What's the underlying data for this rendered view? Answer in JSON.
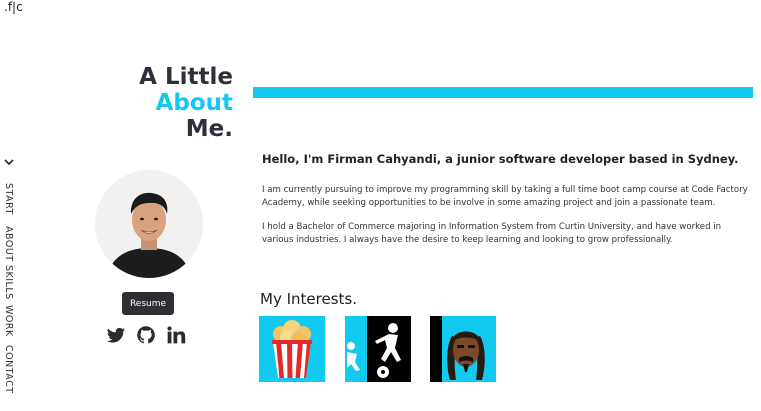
{
  "logo": {
    "text": ".f|c"
  },
  "nav": {
    "items": [
      "START",
      "ABOUT",
      "SKILLS",
      "WORK",
      "CONTACT"
    ]
  },
  "title": {
    "part1": "A Little ",
    "accent": "About",
    "part2": "Me."
  },
  "profile": {
    "resume_label": "Resume",
    "socials": [
      "twitter-icon",
      "github-icon",
      "linkedin-icon"
    ]
  },
  "about": {
    "greeting": "Hello, I'm Firman Cahyandi, a junior software developer based in Sydney.",
    "paragraph1": "I am currently pursuing to improve my programming skill by taking a full time boot camp course at Code Factory Academy, while seeking opportunities to be involve in some amazing project and join a passionate team.",
    "paragraph2": "I hold a Bachelor of Commerce majoring in Information System from Curtin University, and have worked in various industries. I always have the desire to keep learning and looking to grow professionally."
  },
  "interests": {
    "title": "My Interests.",
    "items": [
      "popcorn-icon",
      "football-icon",
      "snoop-dogg-icon"
    ]
  },
  "colors": {
    "accent": "#12c9ef",
    "dark": "#2f2f33"
  }
}
